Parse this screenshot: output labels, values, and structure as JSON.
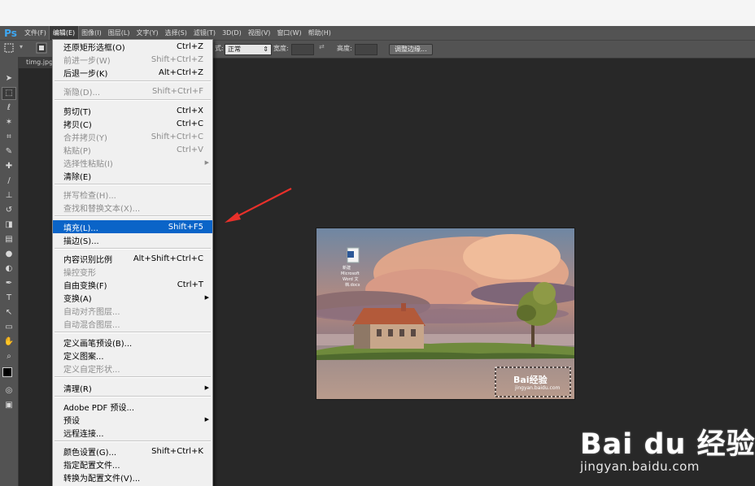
{
  "app": {
    "logo": "Ps",
    "menubar": [
      "文件(F)",
      "编辑(E)",
      "图像(I)",
      "图层(L)",
      "文字(Y)",
      "选择(S)",
      "滤镜(T)",
      "3D(D)",
      "视图(V)",
      "窗口(W)",
      "帮助(H)"
    ],
    "active_menu_index": 1
  },
  "options_bar": {
    "style_label": "式:",
    "style_value": "正常",
    "width_label": "宽度:",
    "height_label": "高度:",
    "refine_edge_button": "调整边缘..."
  },
  "document_tab": "timg.jpg",
  "edit_menu": {
    "items": [
      {
        "label": "还原矩形选框(O)",
        "shortcut": "Ctrl+Z",
        "disabled": false
      },
      {
        "label": "前进一步(W)",
        "shortcut": "Shift+Ctrl+Z",
        "disabled": true
      },
      {
        "label": "后退一步(K)",
        "shortcut": "Alt+Ctrl+Z",
        "disabled": false
      },
      {
        "label": "渐隐(D)...",
        "shortcut": "Shift+Ctrl+F",
        "disabled": true
      },
      {
        "label": "剪切(T)",
        "shortcut": "Ctrl+X",
        "disabled": false
      },
      {
        "label": "拷贝(C)",
        "shortcut": "Ctrl+C",
        "disabled": false
      },
      {
        "label": "合并拷贝(Y)",
        "shortcut": "Shift+Ctrl+C",
        "disabled": true
      },
      {
        "label": "粘贴(P)",
        "shortcut": "Ctrl+V",
        "disabled": true
      },
      {
        "label": "选择性粘贴(I)",
        "shortcut": "",
        "disabled": true,
        "submenu": true
      },
      {
        "label": "清除(E)",
        "shortcut": "",
        "disabled": false
      },
      {
        "label": "拼写检查(H)...",
        "shortcut": "",
        "disabled": true
      },
      {
        "label": "查找和替换文本(X)...",
        "shortcut": "",
        "disabled": true
      },
      {
        "label": "填充(L)...",
        "shortcut": "Shift+F5",
        "disabled": false,
        "highlighted": true
      },
      {
        "label": "描边(S)...",
        "shortcut": "",
        "disabled": false
      },
      {
        "label": "内容识别比例",
        "shortcut": "Alt+Shift+Ctrl+C",
        "disabled": false
      },
      {
        "label": "操控变形",
        "shortcut": "",
        "disabled": true
      },
      {
        "label": "自由变换(F)",
        "shortcut": "Ctrl+T",
        "disabled": false
      },
      {
        "label": "变换(A)",
        "shortcut": "",
        "disabled": false,
        "submenu": true
      },
      {
        "label": "自动对齐图层...",
        "shortcut": "",
        "disabled": true
      },
      {
        "label": "自动混合图层...",
        "shortcut": "",
        "disabled": true
      },
      {
        "label": "定义画笔预设(B)...",
        "shortcut": "",
        "disabled": false
      },
      {
        "label": "定义图案...",
        "shortcut": "",
        "disabled": false
      },
      {
        "label": "定义自定形状...",
        "shortcut": "",
        "disabled": true
      },
      {
        "label": "清理(R)",
        "shortcut": "",
        "disabled": false,
        "submenu": true
      },
      {
        "label": "Adobe PDF 预设...",
        "shortcut": "",
        "disabled": false
      },
      {
        "label": "预设",
        "shortcut": "",
        "disabled": false,
        "submenu": true
      },
      {
        "label": "远程连接...",
        "shortcut": "",
        "disabled": false
      },
      {
        "label": "颜色设置(G)...",
        "shortcut": "Shift+Ctrl+K",
        "disabled": false
      },
      {
        "label": "指定配置文件...",
        "shortcut": "",
        "disabled": false
      },
      {
        "label": "转换为配置文件(V)...",
        "shortcut": "",
        "disabled": false
      }
    ]
  },
  "photo": {
    "desktop_icon_label": "新建 Microsoft Word 文档.docx",
    "watermark_small": "Bai经验",
    "watermark_small_url": "jingyan.baidu.com"
  },
  "watermark": {
    "main": "Bai du 经验",
    "url": "jingyan.baidu.com"
  },
  "colors": {
    "highlight": "#0a64c8",
    "arrow": "#e8302a"
  }
}
